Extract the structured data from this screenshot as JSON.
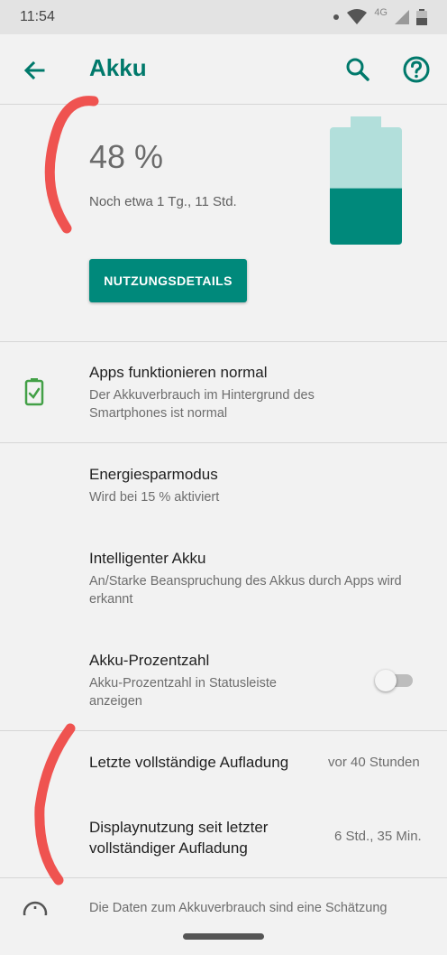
{
  "status_bar": {
    "time": "11:54",
    "network": "4G"
  },
  "app_bar": {
    "title": "Akku"
  },
  "battery": {
    "percent_text": "48 %",
    "level": 0.48,
    "estimate": "Noch etwa 1 Tg., 11 Std.",
    "details_button": "NUTZUNGSDETAILS"
  },
  "rows": {
    "apps_status": {
      "title": "Apps funktionieren normal",
      "subtitle": "Der Akkuverbrauch im Hintergrund des Smartphones ist normal"
    },
    "battery_saver": {
      "title": "Energiesparmodus",
      "subtitle": "Wird bei 15 % aktiviert"
    },
    "adaptive_battery": {
      "title": "Intelligenter Akku",
      "subtitle": "An/Starke Beanspruchung des Akkus durch Apps wird erkannt"
    },
    "battery_percentage": {
      "title": "Akku-Prozentzahl",
      "subtitle": "Akku-Prozentzahl in Statusleiste anzeigen",
      "enabled": false
    },
    "last_full_charge": {
      "title": "Letzte vollständige Aufladung",
      "value": "vor 40 Stunden"
    },
    "screen_usage": {
      "title": "Displaynutzung seit letzter vollständiger Aufladung",
      "value": "6 Std., 35 Min."
    }
  },
  "footer": {
    "text": "Die Daten zum Akkuverbrauch sind eine Schätzung"
  },
  "colors": {
    "accent": "#00796b",
    "button": "#00897b",
    "battery_full": "#00897b",
    "battery_empty": "#b2dfdb",
    "scribble": "#ef5350",
    "status_ok": "#43a047"
  }
}
